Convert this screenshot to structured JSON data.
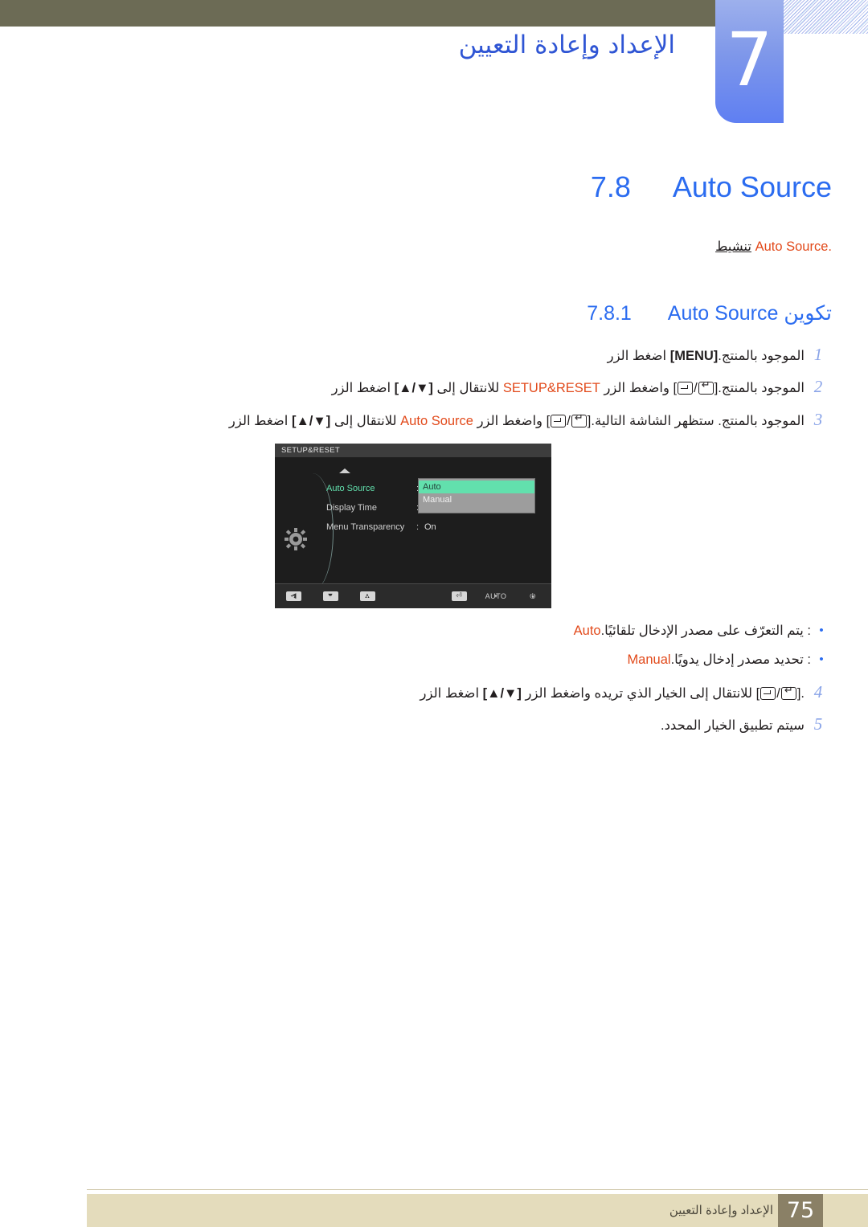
{
  "chapter": {
    "number": "7",
    "title": "الإعداد وإعادة التعيين"
  },
  "section": {
    "number": "7.8",
    "title": "Auto Source",
    "intro_arabic": "تنشيط",
    "intro_term": "Auto Source",
    "intro_period": "."
  },
  "subsection": {
    "number": "7.8.1",
    "title_arabic": "تكوين",
    "title_term": "Auto Source"
  },
  "steps": [
    {
      "n": "1",
      "pre": "اضغط الزر ",
      "key": "[MENU]",
      "post": " الموجود بالمنتج."
    },
    {
      "n": "2",
      "pre": "اضغط الزر ",
      "key": "[▲/▼]",
      "mid": " للانتقال إلى ",
      "term": "SETUP&RESET",
      "mid2": " واضغط الزر ",
      "icons": "[⬜/⏎]",
      "post": " الموجود بالمنتج."
    },
    {
      "n": "3",
      "pre": "اضغط الزر ",
      "key": "[▲/▼]",
      "mid": " للانتقال إلى ",
      "term": "Auto Source",
      "mid2": " واضغط الزر ",
      "icons": "[⬜/⏎]",
      "post": " الموجود بالمنتج. ستظهر الشاشة التالية."
    }
  ],
  "bullets": [
    {
      "term": "Auto",
      "text": ": يتم التعرّف على مصدر الإدخال تلقائيًا."
    },
    {
      "term": "Manual",
      "text": ": تحديد مصدر إدخال يدويًا."
    }
  ],
  "steps_after": [
    {
      "n": "4",
      "pre": "اضغط الزر ",
      "key": "[▲/▼]",
      "mid": " للانتقال إلى الخيار الذي تريده واضغط الزر ",
      "icons": "[⬜/⏎]",
      "post": "."
    },
    {
      "n": "5",
      "pre": "سيتم تطبيق الخيار المحدد.",
      "key": "",
      "mid": "",
      "icons": "",
      "post": ""
    }
  ],
  "osd": {
    "title": "SETUP&RESET",
    "rows": [
      {
        "label": "Auto Source",
        "colon": ":",
        "value": "",
        "selected": true
      },
      {
        "label": "Display Time",
        "colon": ":",
        "value": "",
        "selected": false
      },
      {
        "label": "Menu Transparency",
        "colon": ":",
        "value": "On",
        "selected": false
      }
    ],
    "popup": {
      "options": [
        {
          "label": "Auto",
          "active": true
        },
        {
          "label": "Manual",
          "active": false
        }
      ]
    },
    "buttons": [
      {
        "glyph": "◀",
        "type": "cap"
      },
      {
        "glyph": "▼",
        "type": "cap"
      },
      {
        "glyph": "▲",
        "type": "cap"
      },
      {
        "glyph": "⏎",
        "type": "cap"
      },
      {
        "glyph": "AUTO",
        "type": "lbl"
      },
      {
        "glyph": "⏻",
        "type": "lbl"
      }
    ]
  },
  "footer": {
    "page": "75",
    "text": "الإعداد وإعادة التعيين"
  },
  "colors": {
    "accent_blue": "#2b6cf0",
    "highlight_orange": "#e24a1b",
    "top_bar": "#6c6b55",
    "tab_blue": "#5f7ff2",
    "footer_band": "#e4dcbc",
    "footer_page": "#8a8066",
    "osd_green": "#62e0ad",
    "osd_bg": "#1d1d1d"
  }
}
